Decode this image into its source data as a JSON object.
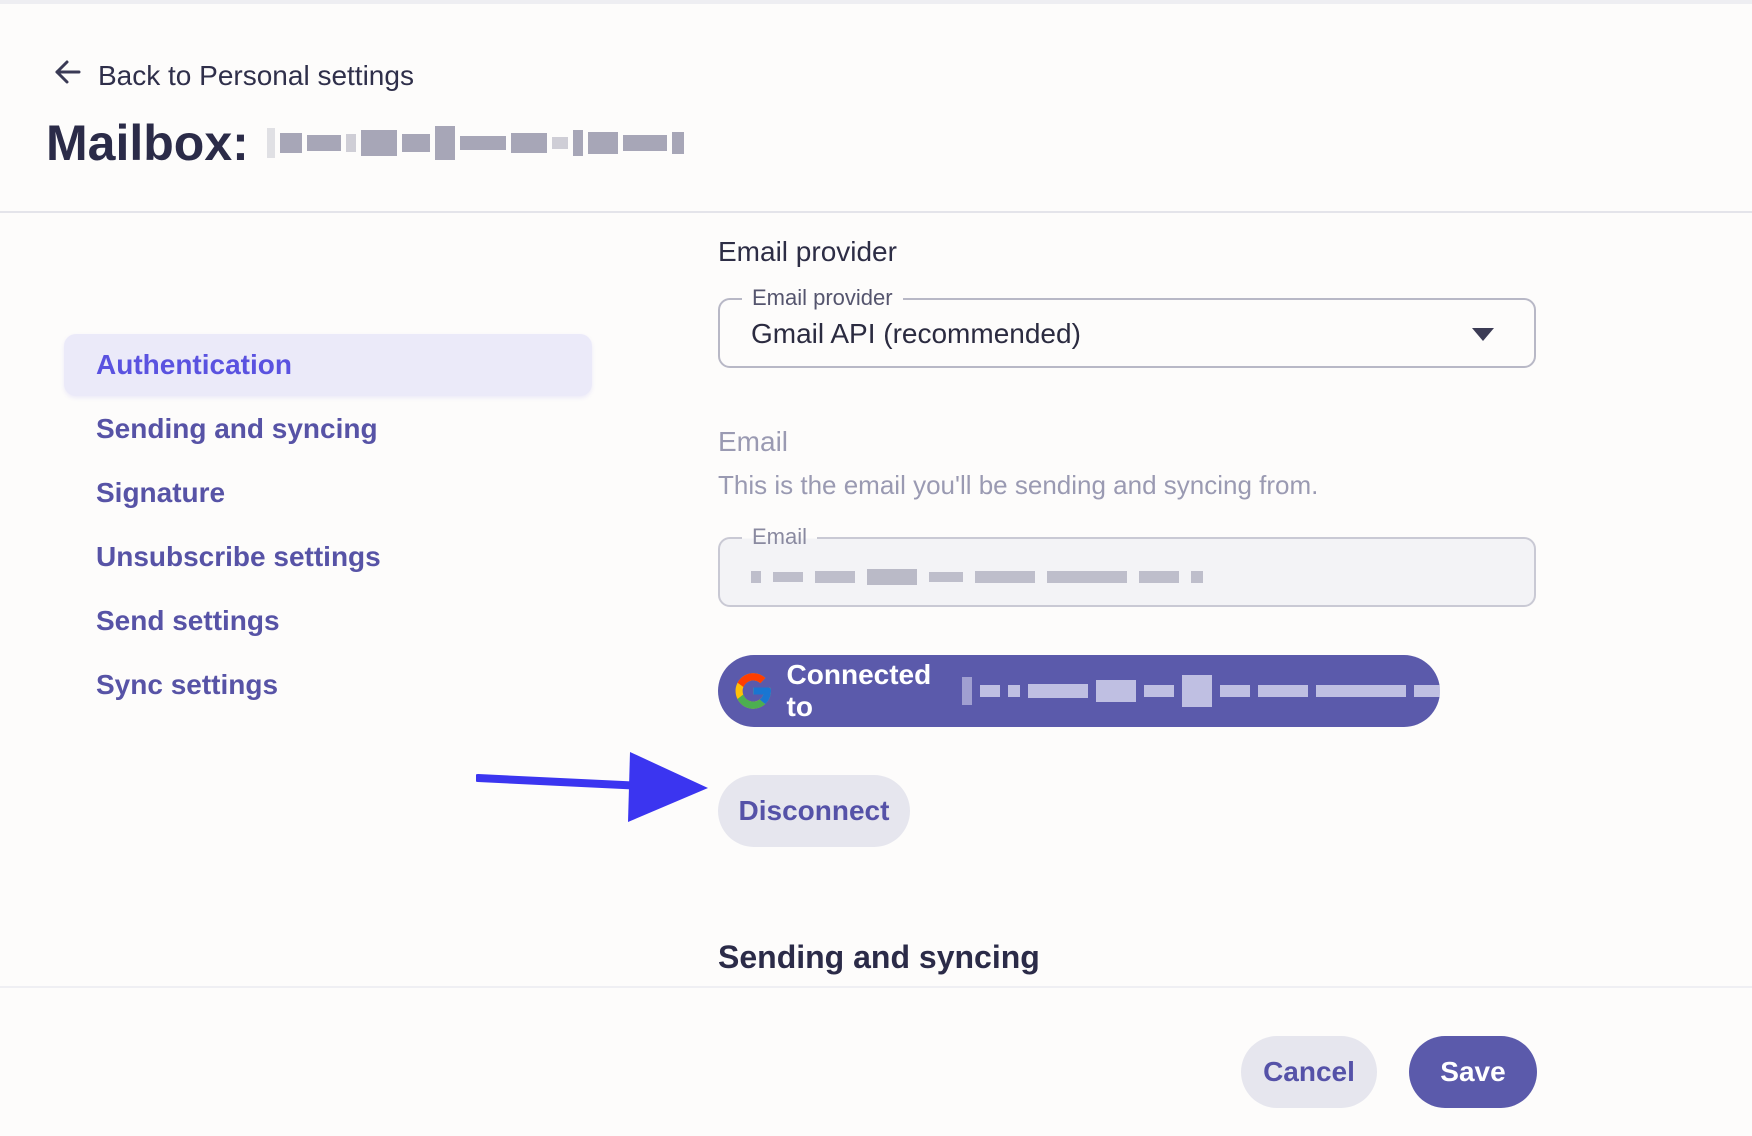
{
  "header": {
    "back_label": "Back to Personal settings",
    "title_prefix": "Mailbox:",
    "title_value_redacted": true
  },
  "sidebar": {
    "items": [
      {
        "label": "Authentication",
        "active": true
      },
      {
        "label": "Sending and syncing",
        "active": false
      },
      {
        "label": "Signature",
        "active": false
      },
      {
        "label": "Unsubscribe settings",
        "active": false
      },
      {
        "label": "Send settings",
        "active": false
      },
      {
        "label": "Sync settings",
        "active": false
      }
    ]
  },
  "main": {
    "provider_section_label": "Email provider",
    "provider_field": {
      "legend": "Email provider",
      "selected": "Gmail API (recommended)"
    },
    "email_heading": "Email",
    "email_help": "This is the email you'll be sending and syncing from.",
    "email_field": {
      "legend": "Email",
      "value_redacted": true
    },
    "connected_label": "Connected to",
    "disconnect_label": "Disconnect",
    "next_section_heading": "Sending and syncing"
  },
  "footer": {
    "cancel_label": "Cancel",
    "save_label": "Save"
  },
  "colors": {
    "accent": "#5b5aab",
    "active_nav_text": "#5a52e0",
    "annotation_arrow": "#3b35f0"
  },
  "icons": {
    "back": "arrow-left-icon",
    "dropdown": "caret-down-icon",
    "provider": "google-logo-icon",
    "annotation": "pointer-arrow-icon"
  }
}
